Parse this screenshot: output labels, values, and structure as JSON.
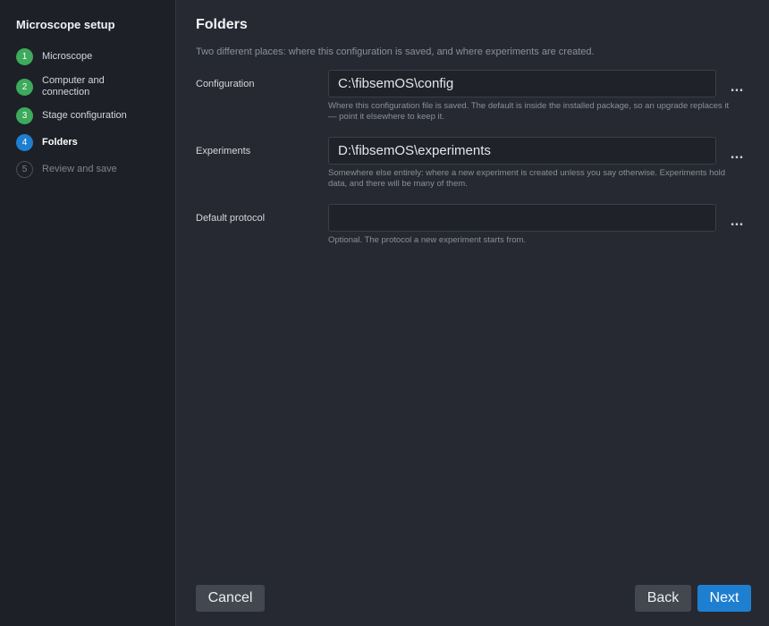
{
  "sidebar": {
    "title": "Microscope setup",
    "steps": [
      {
        "number": "1",
        "label": "Microscope",
        "state": "done"
      },
      {
        "number": "2",
        "label": "Computer and connection",
        "state": "done"
      },
      {
        "number": "3",
        "label": "Stage configuration",
        "state": "done"
      },
      {
        "number": "4",
        "label": "Folders",
        "state": "active"
      },
      {
        "number": "5",
        "label": "Review and save",
        "state": "pending"
      }
    ]
  },
  "main": {
    "title": "Folders",
    "subtitle": "Two different places: where this configuration is saved, and where experiments are created.",
    "fields": {
      "configuration": {
        "label": "Configuration",
        "value": "C:\\fibsemOS\\config",
        "hint": "Where this configuration file is saved. The default is inside the installed package, so an upgrade replaces it — point it elsewhere to keep it.",
        "browse_label": "..."
      },
      "experiments": {
        "label": "Experiments",
        "value": "D:\\fibsemOS\\experiments",
        "hint": "Somewhere else entirely: where a new experiment is created unless you say otherwise. Experiments hold data, and there will be many of them.",
        "browse_label": "..."
      },
      "default_protocol": {
        "label": "Default protocol",
        "value": "",
        "hint": "Optional. The protocol a new experiment starts from.",
        "browse_label": "..."
      }
    }
  },
  "footer": {
    "cancel_label": "Cancel",
    "back_label": "Back",
    "next_label": "Next"
  },
  "colors": {
    "accent": "#1e7fd0",
    "step_done": "#3daa5c",
    "background": "#262931",
    "sidebar": "#1d2027"
  }
}
